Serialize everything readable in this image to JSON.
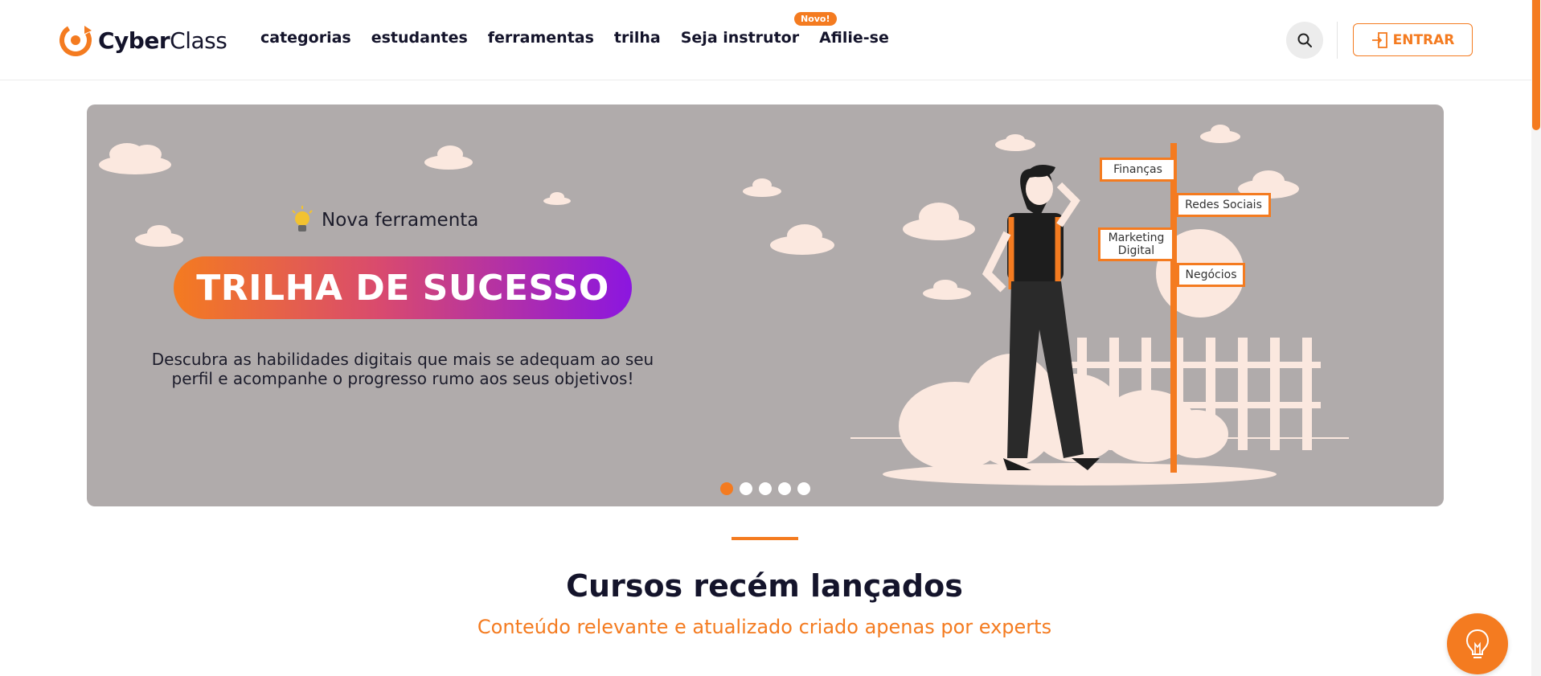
{
  "brand": {
    "name_bold": "Cyber",
    "name_light": "Class",
    "accent": "#f47b20"
  },
  "nav": {
    "items": [
      {
        "label": "categorias"
      },
      {
        "label": "estudantes"
      },
      {
        "label": "ferramentas"
      },
      {
        "label": "trilha"
      },
      {
        "label": "Seja instrutor"
      },
      {
        "label": "Afilie-se"
      }
    ],
    "new_badge": "Novo!"
  },
  "header": {
    "login_label": "ENTRAR",
    "search_icon": "search-icon",
    "login_icon": "door-enter-icon"
  },
  "banner": {
    "tag": "Nova ferramenta",
    "headline": "TRILHA DE SUCESSO",
    "description": "Descubra as habilidades digitais que mais se adequam ao seu perfil e acompanhe o progresso rumo aos seus objetivos!",
    "signs": [
      "Finanças",
      "Redes Sociais",
      "Marketing Digital",
      "Negócios"
    ],
    "slide_count": 5,
    "active_slide": 1,
    "background": "#b0abab"
  },
  "section": {
    "title": "Cursos recém lançados",
    "subtitle": "Conteúdo relevante e atualizado criado apenas por experts"
  },
  "help_button_icon": "lightbulb-icon"
}
